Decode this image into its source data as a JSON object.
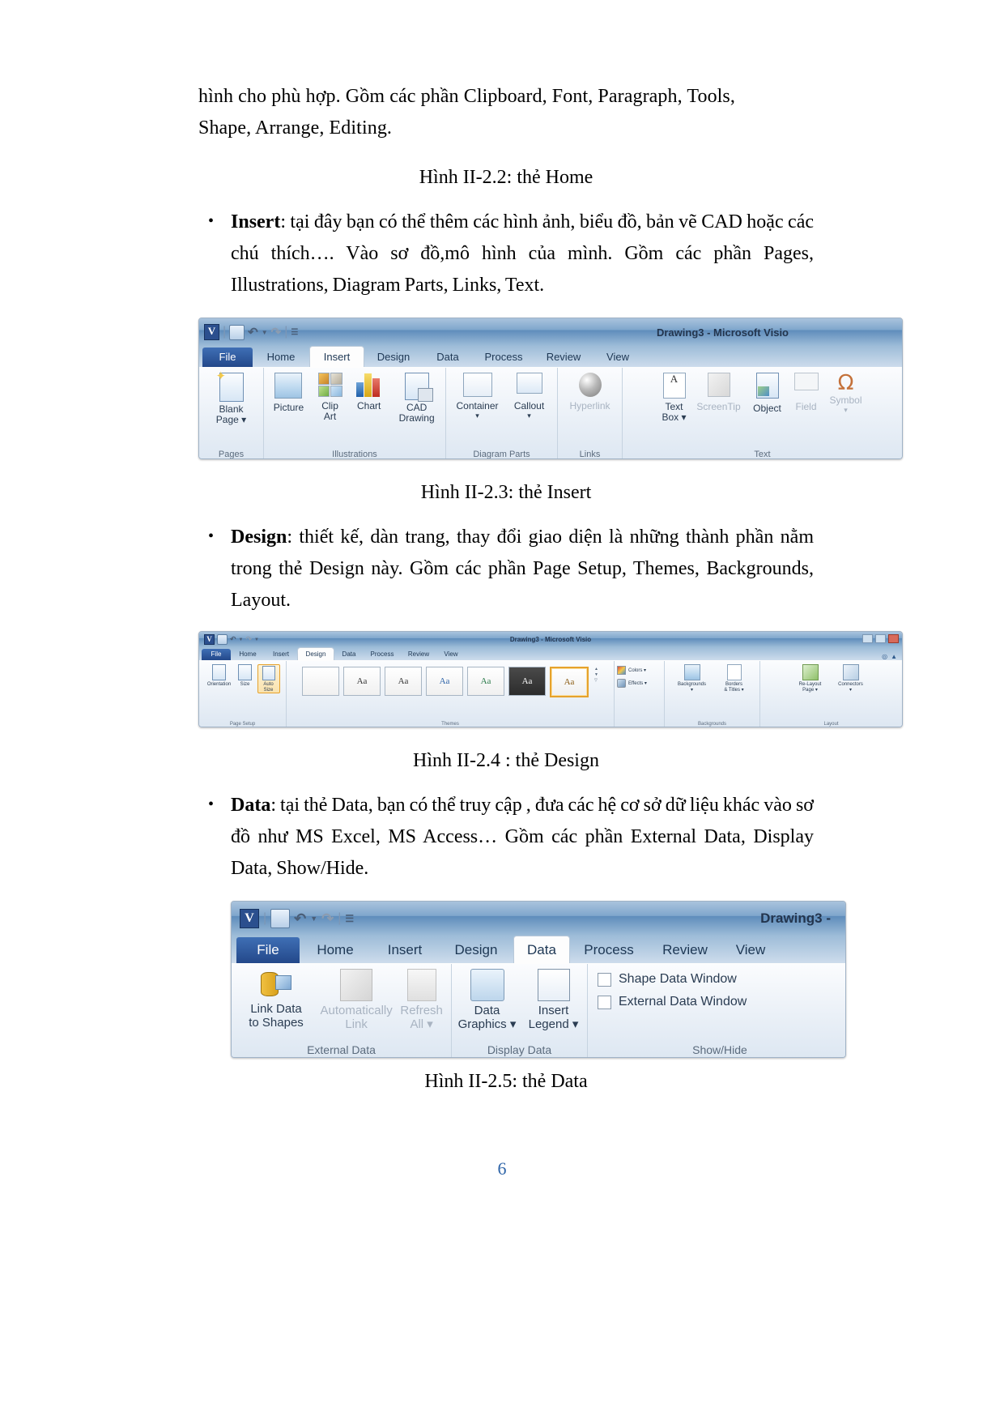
{
  "document": {
    "page_number": "6",
    "paragraph_top_line1": "hình cho phù hợp. Gồm các phần Clipboard, Font, Paragraph, Tools,",
    "paragraph_top_line2": "Shape, Arrange, Editing."
  },
  "captions": {
    "home": "Hình II-2.2: thẻ Home",
    "insert": "Hình II-2.3: thẻ Insert",
    "design": "Hình II-2.4 : thẻ Design",
    "data": "Hình II-2.5: thẻ Data"
  },
  "bullets": [
    {
      "label": "Insert",
      "text": ": tại đây bạn có thể thêm các hình ảnh, biểu đồ, bản vẽ CAD hoặc các chú thích…. Vào sơ đồ,mô hình của mình. Gồm các phần Pages, Illustrations, Diagram Parts, Links, Text."
    },
    {
      "label": "Design",
      "text": ": thiết kế, dàn trang, thay đổi giao diện là những thành phần nằm trong thẻ Design này. Gồm các phần Page Setup, Themes, Backgrounds, Layout."
    },
    {
      "label": "Data",
      "text": ": tại thẻ Data, bạn có thể truy cập , đưa các hệ cơ sở dữ liệu khác vào sơ đồ như MS Excel, MS Access… Gồm các phần External Data, Display Data, Show/Hide."
    }
  ],
  "ribbon_insert": {
    "window_title": "Drawing3  -  Microsoft Visio",
    "qat": {
      "logo": "V",
      "save_icon": "save-icon",
      "undo_icon": "undo-icon",
      "redo_icon": "redo-icon",
      "customize_icon": "customize-qat-icon"
    },
    "tabs": [
      "File",
      "Home",
      "Insert",
      "Design",
      "Data",
      "Process",
      "Review",
      "View"
    ],
    "active_tab": "Insert",
    "groups": [
      {
        "name": "Pages",
        "items": [
          {
            "label": "Blank\nPage ▾",
            "label_line1": "Blank",
            "label_line2": "Page ▾",
            "icon": "blank-page-icon",
            "disabled": false
          }
        ]
      },
      {
        "name": "Illustrations",
        "items": [
          {
            "label_line1": "Picture",
            "label_line2": "",
            "icon": "picture-icon",
            "disabled": false
          },
          {
            "label_line1": "Clip",
            "label_line2": "Art",
            "icon": "clip-art-icon",
            "disabled": false
          },
          {
            "label_line1": "Chart",
            "label_line2": "",
            "icon": "chart-icon",
            "disabled": false
          },
          {
            "label_line1": "CAD",
            "label_line2": "Drawing",
            "icon": "cad-drawing-icon",
            "disabled": false
          }
        ]
      },
      {
        "name": "Diagram Parts",
        "items": [
          {
            "label_line1": "Container",
            "label_line2": "▾",
            "icon": "container-icon",
            "disabled": false
          },
          {
            "label_line1": "Callout",
            "label_line2": "▾",
            "icon": "callout-icon",
            "disabled": false
          }
        ]
      },
      {
        "name": "Links",
        "items": [
          {
            "label_line1": "Hyperlink",
            "label_line2": "",
            "icon": "hyperlink-icon",
            "disabled": true
          }
        ]
      },
      {
        "name": "Text",
        "items": [
          {
            "label_line1": "Text",
            "label_line2": "Box ▾",
            "icon": "text-box-icon",
            "disabled": false
          },
          {
            "label_line1": "ScreenTip",
            "label_line2": "",
            "icon": "screentip-icon",
            "disabled": true
          },
          {
            "label_line1": "Object",
            "label_line2": "",
            "icon": "object-icon",
            "disabled": false
          },
          {
            "label_line1": "Field",
            "label_line2": "",
            "icon": "field-icon",
            "disabled": true
          },
          {
            "label_line1": "Symbol",
            "label_line2": "▾",
            "icon": "symbol-icon",
            "disabled": true
          }
        ]
      }
    ]
  },
  "ribbon_design": {
    "window_title": "Drawing3 - Microsoft Visio",
    "tabs": [
      "File",
      "Home",
      "Insert",
      "Design",
      "Data",
      "Process",
      "Review",
      "View"
    ],
    "active_tab": "Design",
    "groups": [
      {
        "name": "Page Setup",
        "items": [
          {
            "label_line1": "Orientation",
            "label_line2": "▾",
            "icon": "orientation-icon"
          },
          {
            "label_line1": "Size",
            "label_line2": "▾",
            "icon": "page-size-icon"
          },
          {
            "label_line1": "Auto",
            "label_line2": "Size",
            "icon": "auto-size-icon"
          }
        ]
      },
      {
        "name": "Themes",
        "thumbs": [
          "",
          "Aa",
          "Aa",
          "Aa",
          "Aa",
          "Aa",
          "Aa"
        ],
        "selected_index": 5
      },
      {
        "name": "",
        "items": [
          {
            "label_line1": "Colors ▾",
            "icon": "colors-icon"
          },
          {
            "label_line1": "Effects ▾",
            "icon": "effects-icon"
          }
        ]
      },
      {
        "name": "Backgrounds",
        "items": [
          {
            "label_line1": "Backgrounds",
            "label_line2": "▾",
            "icon": "backgrounds-icon"
          },
          {
            "label_line1": "Borders",
            "label_line2": "& Titles ▾",
            "icon": "borders-titles-icon"
          }
        ]
      },
      {
        "name": "Layout",
        "items": [
          {
            "label_line1": "Re-Layout",
            "label_line2": "Page ▾",
            "icon": "re-layout-page-icon"
          },
          {
            "label_line1": "Connectors",
            "label_line2": "▾",
            "icon": "connectors-icon"
          }
        ]
      }
    ]
  },
  "ribbon_data": {
    "window_title": "Drawing3 -",
    "tabs": [
      "File",
      "Home",
      "Insert",
      "Design",
      "Data",
      "Process",
      "Review",
      "View"
    ],
    "active_tab": "Data",
    "groups": [
      {
        "name": "External Data",
        "items": [
          {
            "label_line1": "Link Data",
            "label_line2": "to Shapes",
            "icon": "link-data-icon",
            "disabled": false
          },
          {
            "label_line1": "Automatically",
            "label_line2": "Link",
            "icon": "automatically-link-icon",
            "disabled": true
          },
          {
            "label_line1": "Refresh",
            "label_line2": "All ▾",
            "icon": "refresh-all-icon",
            "disabled": true
          }
        ]
      },
      {
        "name": "Display Data",
        "items": [
          {
            "label_line1": "Data",
            "label_line2": "Graphics ▾",
            "icon": "data-graphics-icon",
            "disabled": false
          },
          {
            "label_line1": "Insert",
            "label_line2": "Legend ▾",
            "icon": "insert-legend-icon",
            "disabled": false
          }
        ]
      },
      {
        "name": "Show/Hide",
        "checkboxes": [
          {
            "label": "Shape Data Window",
            "checked": false
          },
          {
            "label": "External Data Window",
            "checked": false
          }
        ]
      }
    ]
  },
  "colors": {
    "page_number": "#2e64a8",
    "file_tab": "#23488a",
    "titlebar": "#5e8cbb",
    "theme_accent": "#e6a22c"
  }
}
